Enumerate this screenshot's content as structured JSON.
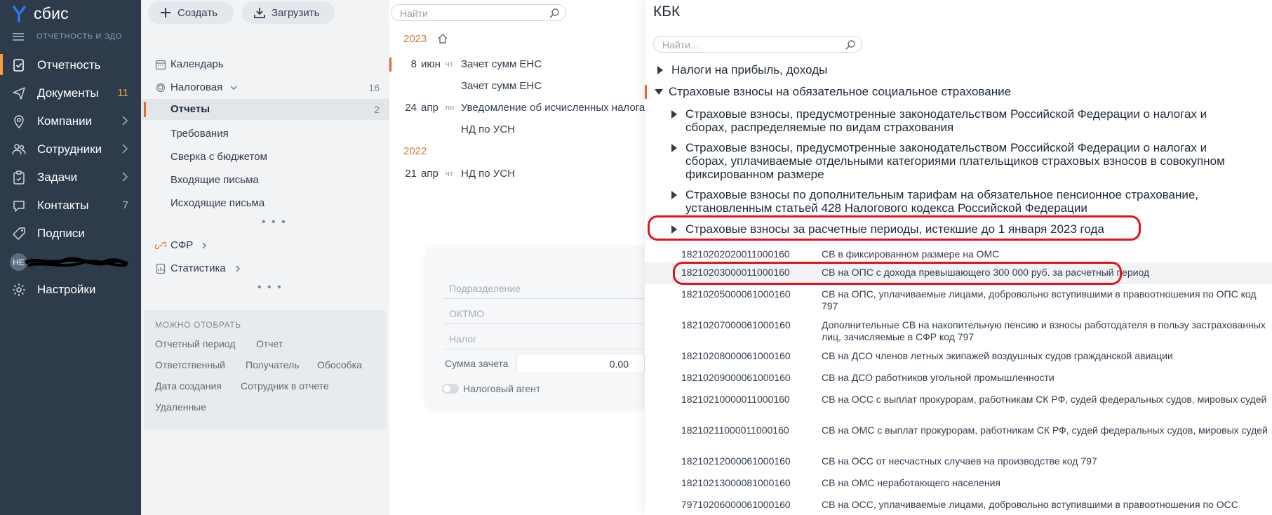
{
  "app": {
    "logo_text": "сбис",
    "section_label": "ОТЧЕТНОСТЬ И ЭДО"
  },
  "sidebar": {
    "items": [
      {
        "label": "Отчетность",
        "count": ""
      },
      {
        "label": "Документы",
        "count": "11"
      },
      {
        "label": "Компании",
        "count": ""
      },
      {
        "label": "Сотрудники",
        "count": ""
      },
      {
        "label": "Задачи",
        "count": ""
      },
      {
        "label": "Контакты",
        "count": "7"
      },
      {
        "label": "Подписи",
        "count": ""
      },
      {
        "label": "Настройки",
        "count": ""
      }
    ],
    "user_initials": "НЕ"
  },
  "toolbar": {
    "create_label": "Создать",
    "upload_label": "Загрузить"
  },
  "tree": {
    "calendar": "Календарь",
    "tax": {
      "label": "Налоговая",
      "count": "16"
    },
    "reports": {
      "label": "Отчеты",
      "count": "2"
    },
    "requirements": "Требования",
    "budget": "Сверка с бюджетом",
    "incoming": "Входящие письма",
    "outgoing": "Исходящие письма",
    "sfr": "СФР",
    "stats": "Статистика",
    "more": "• • •"
  },
  "filters": {
    "title": "МОЖНО ОТОБРАТЬ",
    "items": [
      "Отчетный период",
      "Отчет",
      "Ответственный",
      "Получатель",
      "Обособка",
      "Дата создания",
      "Сотрудник в отчете",
      "Удаленные"
    ]
  },
  "list": {
    "search_placeholder": "Найти",
    "year1": "2023",
    "year2": "2022",
    "rows": [
      {
        "day": "8",
        "month": "июн",
        "weekday": "чт",
        "title": "Зачет сумм ЕНС"
      },
      {
        "day": "",
        "month": "",
        "weekday": "",
        "title": "Зачет сумм ЕНС"
      },
      {
        "day": "24",
        "month": "апр",
        "weekday": "пн",
        "title": "Уведомление об исчисленных налогах"
      },
      {
        "day": "",
        "month": "",
        "weekday": "",
        "title": "НД по УСН"
      },
      {
        "day": "21",
        "month": "апр",
        "weekday": "чт",
        "title": "НД по УСН"
      }
    ]
  },
  "dialog": {
    "subdivision": "Подразделение",
    "oktmo": "ОКТМО",
    "tax": "Налог",
    "sum_label": "Сумма зачета",
    "sum_value": "0.00",
    "agent_label": "Налоговый агент"
  },
  "kbk": {
    "title": "КБК",
    "search_placeholder": "Найти...",
    "groups": [
      "Налоги на прибыль, доходы",
      "Страховые взносы на обязательное социальное страхование",
      "Страховые взносы, предусмотренные законодательством Российской Федерации о налогах и сборах, распределяемые по видам страхования",
      "Страховые взносы, предусмотренные законодательством Российской Федерации о налогах и сборах, уплачиваемые отдельными категориями плательщиков страховых взносов в совокупном фиксированном размере",
      "Страховые взносы по дополнительным тарифам на обязательное пенсионное страхование, установленным статьей 428 Налогового кодекса Российской Федерации",
      "Страховые взносы за расчетные периоды, истекшие до 1 января 2023 года"
    ],
    "codes": [
      {
        "code": "18210202020011000160",
        "desc": "СВ в фиксированном размере на ОМС"
      },
      {
        "code": "18210203000011000160",
        "desc": "СВ на ОПС с дохода превышающего 300 000 руб. за расчетный период"
      },
      {
        "code": "18210205000061000160",
        "desc": "СВ на ОПС, уплачиваемые лицами, добровольно вступившими в правоотношения по ОПС код 797"
      },
      {
        "code": "18210207000061000160",
        "desc": "Дополнительные СВ на накопительную пенсию и взносы работодателя в пользу застрахованных лиц, зачисляемые в СФР код 797"
      },
      {
        "code": "18210208000061000160",
        "desc": "СВ на ДСО членов летных экипажей воздушных судов гражданской авиации"
      },
      {
        "code": "18210209000061000160",
        "desc": "СВ на ДСО работников угольной промышленности"
      },
      {
        "code": "18210210000011000160",
        "desc": "СВ на ОСС с выплат прокурорам, работникам СК РФ, судей федеральных судов, мировых судей"
      },
      {
        "code": "18210211000011000160",
        "desc": "СВ на ОМС с выплат прокурорам, работникам СК РФ, судей федеральных судов, мировых судей"
      },
      {
        "code": "18210212000061000160",
        "desc": "СВ на ОСС от несчастных случаев на производстве код 797"
      },
      {
        "code": "18210213000081000160",
        "desc": "СВ на ОМС неработающего населения"
      },
      {
        "code": "79710206000061000160",
        "desc": "СВ на ОСС, уплачиваемые лицами, добровольно вступившими в правоотношения по ОСС"
      }
    ]
  },
  "colors": {
    "accent": "#f59f3e",
    "selection_bar": "#e06a29",
    "annotation": "#e0141e",
    "sidebar_bg": "#2e3b4b"
  }
}
